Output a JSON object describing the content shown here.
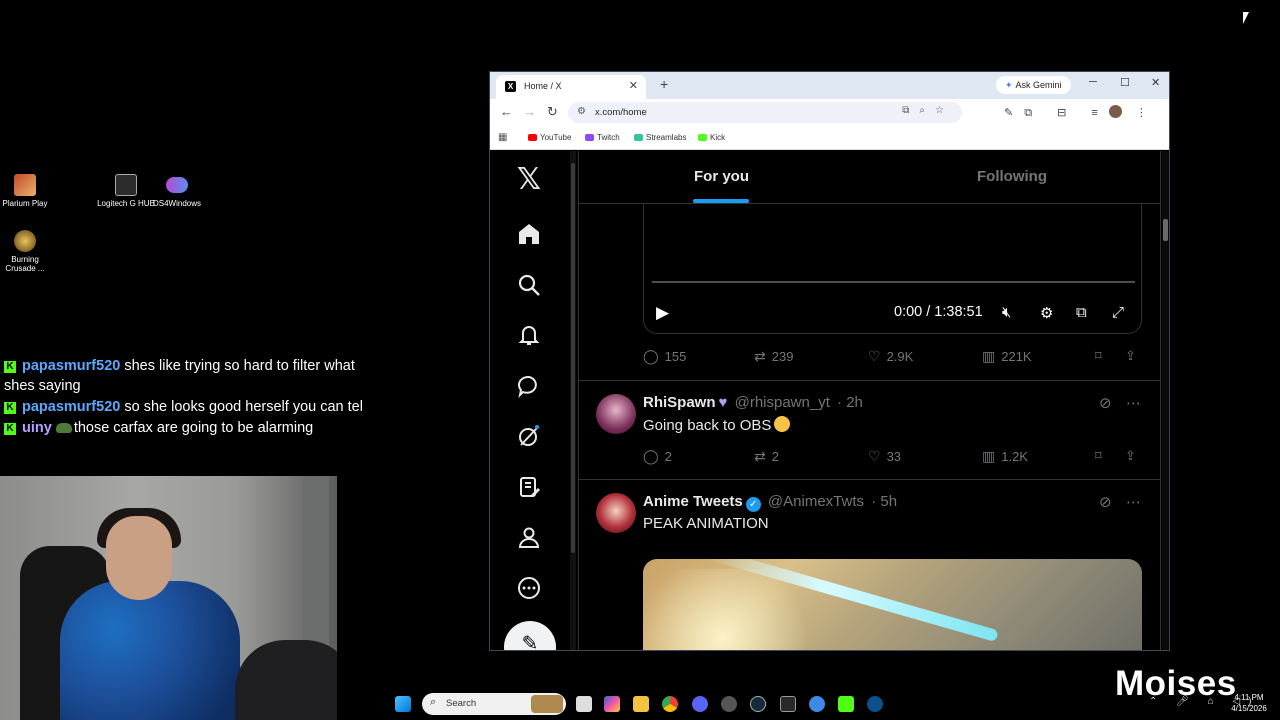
{
  "desktop": {
    "icons": [
      {
        "label": "Plarium Play"
      },
      {
        "label": "Logitech G HUB"
      },
      {
        "label": "DS4Windows"
      },
      {
        "label": "Burning Crusade ..."
      }
    ]
  },
  "chat": {
    "messages": [
      {
        "user": "papasmurf520",
        "text": "shes like trying so hard to filter what shes saying"
      },
      {
        "user": "papasmurf520",
        "text": "so she looks good herself you can tel"
      },
      {
        "user": "uiny",
        "text": "those carfax are going to be alarming"
      }
    ]
  },
  "browser": {
    "tab_title": "Home / X",
    "ask_gemini": "Ask Gemini",
    "url": "x.com/home",
    "bookmarks": [
      "YouTube",
      "Twitch",
      "Streamlabs",
      "Kick"
    ],
    "colors": {
      "youtube": "#ff0000",
      "twitch": "#9146ff",
      "streamlabs": "#31c3a2",
      "kick": "#53fc18"
    }
  },
  "x": {
    "nav_icons": [
      "x-logo-icon",
      "home-icon",
      "search-icon",
      "notifications-icon",
      "messages-icon",
      "grok-icon",
      "lists-icon",
      "profile-icon",
      "more-icon",
      "post-icon"
    ],
    "tabs": {
      "for_you": "For you",
      "following": "Following"
    },
    "accent": "#1d9bf0",
    "video": {
      "time": "0:00 / 1:38:51"
    },
    "first_actions": {
      "replies": "155",
      "reposts": "239",
      "likes": "2.9K",
      "views": "221K"
    },
    "tweets": [
      {
        "name": "RhiSpawn",
        "handle": "@rhispawn_yt",
        "age": "· 2h",
        "text": "Going back to OBS",
        "replies": "2",
        "reposts": "2",
        "likes": "33",
        "views": "1.2K"
      },
      {
        "name": "Anime Tweets",
        "handle": "@AnimexTwts",
        "age": "· 5h",
        "text": "PEAK ANIMATION"
      }
    ]
  },
  "taskbar": {
    "search_placeholder": "Search",
    "time": "4:11 PM",
    "date": "4/15/2026"
  },
  "watermark": "Moises"
}
